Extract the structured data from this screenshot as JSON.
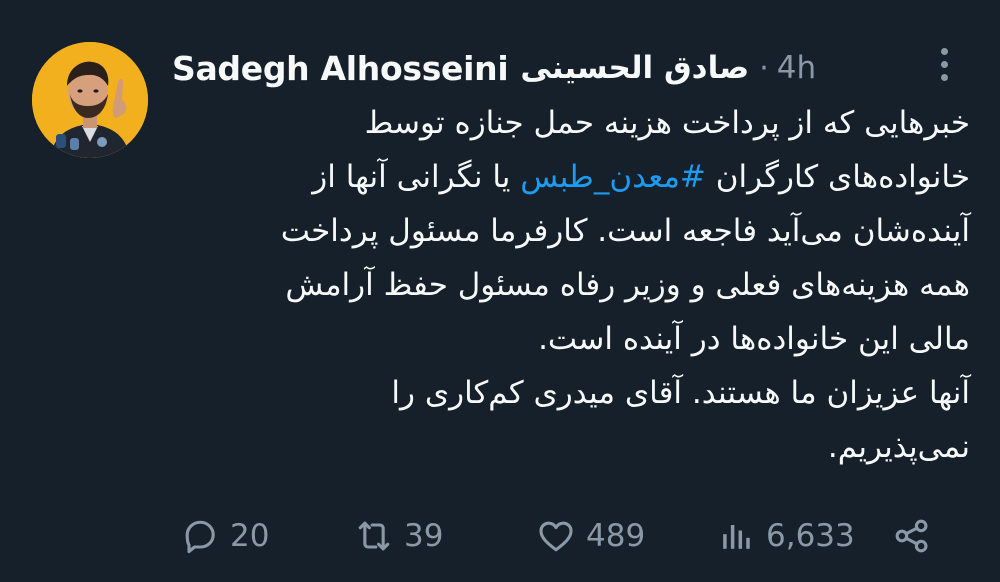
{
  "author": {
    "name": "Sadegh Alhosseini",
    "name_native": "صادق الحسینی",
    "separator": "·",
    "time": "4h"
  },
  "tweet": {
    "lines": [
      {
        "text": "خبرهایی که از پرداخت هزینه حمل جنازه توسط"
      },
      {
        "before": "خانواده‌های کارگران ",
        "hashtag": "#معدن_طبس",
        "after": " یا نگرانی آنها از"
      },
      {
        "text": "آینده‌شان می‌آید فاجعه است. کارفرما مسئول پرداخت"
      },
      {
        "text": "همه هزینه‌های فعلی و وزیر رفاه مسئول حفظ آرامش"
      },
      {
        "text": "مالی این خانواده‌ها در آینده است."
      },
      {
        "text": "آنها عزیزان ما هستند. آقای میدری کم‌کاری را"
      },
      {
        "text": "نمی‌پذیریم."
      }
    ]
  },
  "actions": {
    "replies": "20",
    "retweets": "39",
    "likes": "489",
    "views": "6,633"
  },
  "colors": {
    "background": "#15202b",
    "text": "#f7f9f9",
    "muted": "#8b98a5",
    "link": "#1d9bf0",
    "avatar_bg": "#f2b01e"
  },
  "icons": {
    "reply": "reply-icon",
    "retweet": "retweet-icon",
    "like": "heart-icon",
    "views": "views-icon",
    "share": "share-icon",
    "more": "more-vertical-icon"
  }
}
